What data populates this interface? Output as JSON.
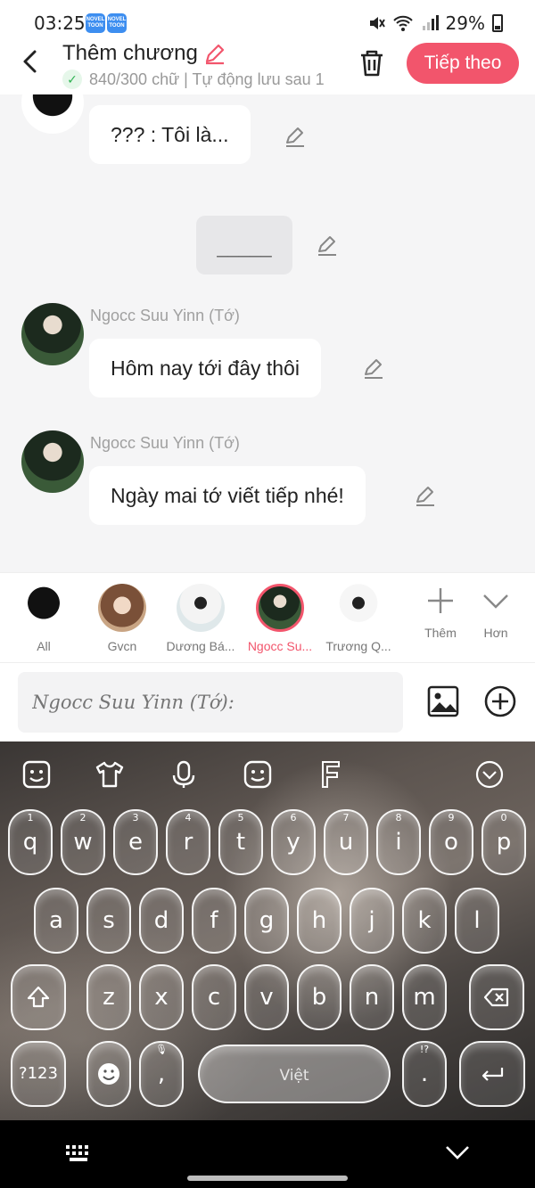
{
  "status_bar": {
    "time": "03:25",
    "badge_label": "NOVEL TOON",
    "battery": "29%"
  },
  "header": {
    "title": "Thêm chương",
    "subtitle": "840/300 chữ | Tự động lưu sau 1",
    "next_button": "Tiếp theo"
  },
  "chat": {
    "messages": [
      {
        "speaker": "",
        "text": "??? : Tôi là..."
      },
      {
        "speaker": "",
        "text": "_____"
      },
      {
        "speaker": "Ngocc Suu Yinn (Tớ)",
        "text": "Hôm nay tới đây thôi"
      },
      {
        "speaker": "Ngocc Suu Yinn (Tớ)",
        "text": "Ngày mai tớ viết tiếp nhé!"
      }
    ]
  },
  "characters": [
    {
      "label": "All",
      "active": false
    },
    {
      "label": "Gvcn",
      "active": false
    },
    {
      "label": "Dương Bá...",
      "active": false
    },
    {
      "label": "Ngocc Su...",
      "active": true
    },
    {
      "label": "Trương Q...",
      "active": false
    }
  ],
  "actions": {
    "more_label": "Thêm",
    "expand_label": "Hơn"
  },
  "input": {
    "placeholder": "Ngocc Suu Yinn (Tớ):"
  },
  "keyboard": {
    "row1": [
      {
        "k": "q",
        "n": "1"
      },
      {
        "k": "w",
        "n": "2"
      },
      {
        "k": "e",
        "n": "3"
      },
      {
        "k": "r",
        "n": "4"
      },
      {
        "k": "t",
        "n": "5"
      },
      {
        "k": "y",
        "n": "6"
      },
      {
        "k": "u",
        "n": "7"
      },
      {
        "k": "i",
        "n": "8"
      },
      {
        "k": "o",
        "n": "9"
      },
      {
        "k": "p",
        "n": "0"
      }
    ],
    "row2": [
      "a",
      "s",
      "d",
      "f",
      "g",
      "h",
      "j",
      "k",
      "l"
    ],
    "row3": [
      "z",
      "x",
      "c",
      "v",
      "b",
      "n",
      "m"
    ],
    "symbols_key": "?123",
    "comma_key": ",",
    "space_label": "Việt",
    "period_key": ".",
    "period_hint": "!?"
  },
  "colors": {
    "accent": "#f2556c",
    "chat_bg": "#f5f5f6",
    "success": "#2fb352"
  }
}
